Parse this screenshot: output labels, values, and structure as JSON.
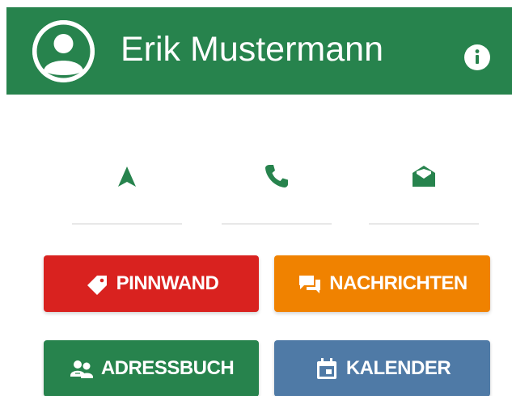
{
  "profile": {
    "name": "Erik Mustermann"
  },
  "actions": [
    {
      "id": "navigate",
      "icon": "navigation-arrow-icon"
    },
    {
      "id": "call",
      "icon": "phone-icon"
    },
    {
      "id": "email",
      "icon": "open-envelope-icon"
    }
  ],
  "tiles": {
    "pinnwand": {
      "label": "PINNWAND",
      "icon": "tag-icon",
      "color": "#d9221f"
    },
    "nachrichten": {
      "label": "NACHRICHTEN",
      "icon": "chat-bubbles-icon",
      "color": "#f08200"
    },
    "adressbuch": {
      "label": "ADRESSBUCH",
      "icon": "contacts-icon",
      "color": "#27834d"
    },
    "kalender": {
      "label": "KALENDER",
      "icon": "calendar-icon",
      "color": "#4f7aa6"
    }
  },
  "colors": {
    "header": "#27834d",
    "accent_icon": "#27834d"
  }
}
